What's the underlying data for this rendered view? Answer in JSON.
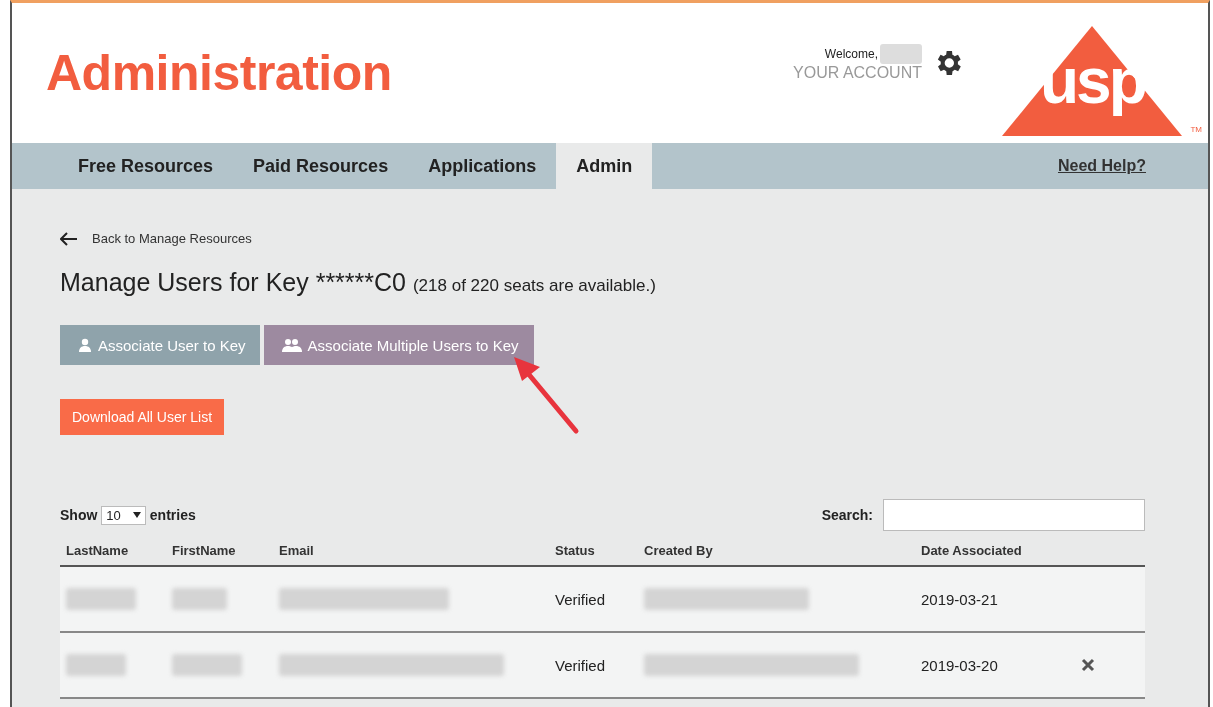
{
  "header": {
    "title": "Administration",
    "welcome": "Welcome,",
    "account_link": "YOUR ACCOUNT",
    "logo_text": "usp",
    "trademark": "TM"
  },
  "nav": {
    "tabs": [
      {
        "label": "Free Resources",
        "selected": false
      },
      {
        "label": "Paid Resources",
        "selected": false
      },
      {
        "label": "Applications",
        "selected": false
      },
      {
        "label": "Admin",
        "selected": true
      }
    ],
    "help_link": "Need Help?"
  },
  "back_link": "Back to Manage Resources",
  "heading": {
    "title": "Manage Users for Key ******C0",
    "note": "(218 of 220 seats are available.)"
  },
  "buttons": [
    {
      "label": "Associate User to Key",
      "kind": "single"
    },
    {
      "label": "Associate Multiple Users to Key",
      "kind": "multiple"
    }
  ],
  "download_button": "Download All User List",
  "table": {
    "show_label": "Show",
    "page_size": "10",
    "entries_label": "entries",
    "search_label": "Search:",
    "columns": [
      "LastName",
      "FirstName",
      "Email",
      "Status",
      "Created By",
      "Date Associated"
    ],
    "rows": [
      {
        "status": "Verified",
        "date_associated": "2019-03-21",
        "removable": false
      },
      {
        "status": "Verified",
        "date_associated": "2019-03-20",
        "removable": true
      }
    ]
  }
}
